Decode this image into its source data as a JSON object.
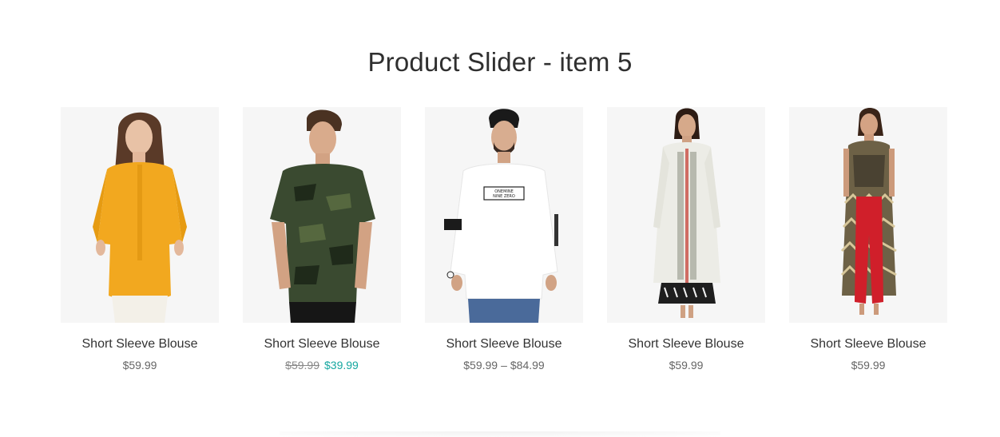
{
  "section": {
    "title": "Product Slider - item 5"
  },
  "products": [
    {
      "name": "Short Sleeve Blouse",
      "price": "$59.99",
      "image": "woman-yellow-top-photo"
    },
    {
      "name": "Short Sleeve Blouse",
      "old_price": "$59.99",
      "sale_price": "$39.99",
      "image": "man-camo-tshirt-photo"
    },
    {
      "name": "Short Sleeve Blouse",
      "price_min": "$59.99",
      "price_sep": "–",
      "price_max": "$84.99",
      "image": "man-white-longsleeve-photo",
      "print_text_line1": "ONEMINE",
      "print_text_line2": "NINE ZERO"
    },
    {
      "name": "Short Sleeve Blouse",
      "price": "$59.99",
      "image": "woman-white-kurta-photo"
    },
    {
      "name": "Short Sleeve Blouse",
      "price": "$59.99",
      "image": "woman-printed-kurta-red-palazzo-photo"
    }
  ],
  "colors": {
    "sale_price": "#16a7a0",
    "title": "#2f2f2f",
    "image_background": "#f6f6f6"
  }
}
